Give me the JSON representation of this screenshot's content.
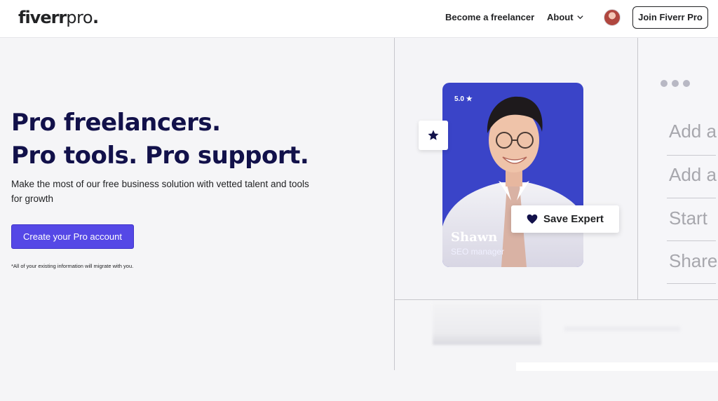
{
  "header": {
    "logo_main": "fiverr",
    "logo_pro": "pro",
    "logo_dot": ".",
    "nav_become_freelancer": "Become a freelancer",
    "nav_about": "About",
    "join_button": "Join Fiverr Pro"
  },
  "hero": {
    "title_line1": "Pro freelancers.",
    "title_line2": "Pro tools. Pro support.",
    "subtitle": "Make the most of our free business solution with vetted talent and tools for growth",
    "cta_button": "Create your Pro account",
    "footnote": "*All of your existing information will migrate with you."
  },
  "expert_card": {
    "rating": "5.0",
    "name": "Shawn",
    "role": "SEO manager",
    "save_button": "Save Expert"
  },
  "side_panel": {
    "items": [
      "Add a",
      "Add a",
      "Start",
      "Share"
    ]
  },
  "colors": {
    "brand_dark": "#12114a",
    "cta_purple": "#5548e6",
    "card_blue": "#3a44c8"
  },
  "icons": [
    "chevron-down-icon",
    "avatar",
    "star-icon",
    "heart-icon",
    "more-dots-icon"
  ]
}
